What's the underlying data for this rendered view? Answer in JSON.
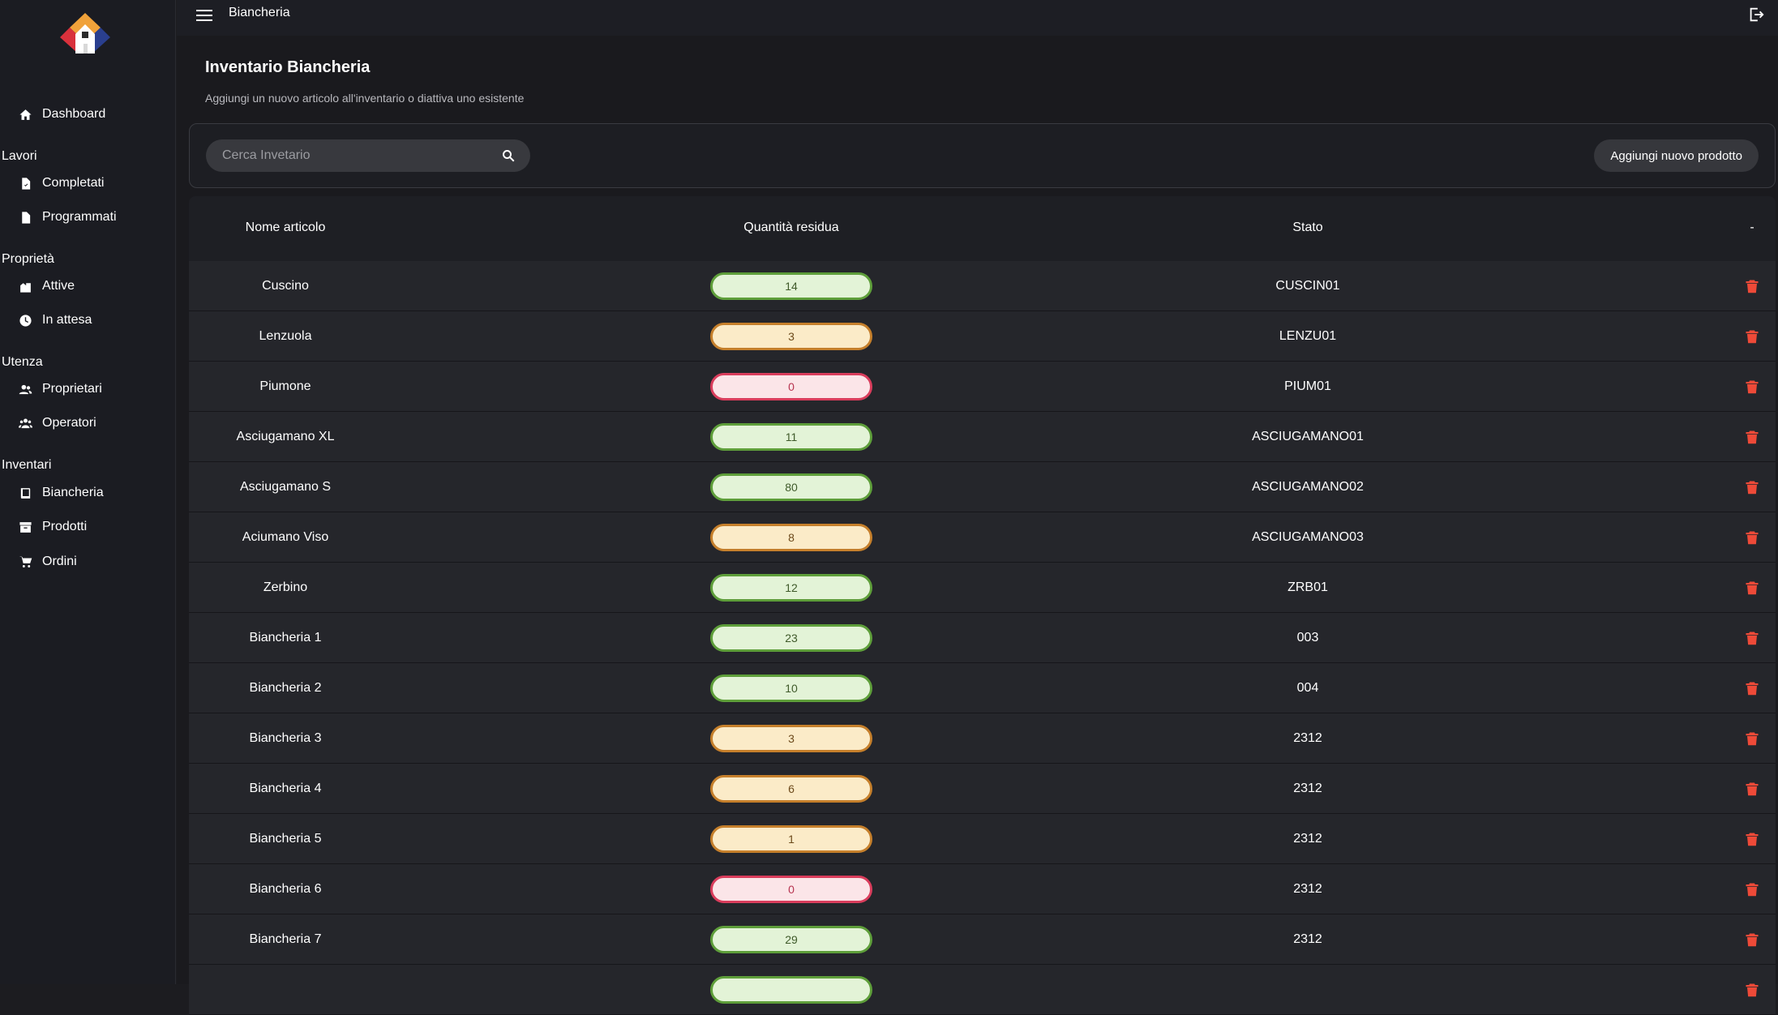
{
  "topbar": {
    "title": "Biancheria"
  },
  "sidebar": {
    "dashboard": "Dashboard",
    "sections": {
      "lavori": "Lavori",
      "proprieta": "Proprietà",
      "utenza": "Utenza",
      "inventari": "Inventari"
    },
    "items": {
      "completati": "Completati",
      "programmati": "Programmati",
      "attive": "Attive",
      "in_attesa": "In attesa",
      "proprietari": "Proprietari",
      "operatori": "Operatori",
      "biancheria": "Biancheria",
      "prodotti": "Prodotti",
      "ordini": "Ordini"
    }
  },
  "page": {
    "title": "Inventario Biancheria",
    "subtitle": "Aggiungi un nuovo articolo all'inventario o diattiva uno esistente"
  },
  "search": {
    "placeholder": "Cerca Invetario"
  },
  "actions": {
    "add_label": "Aggiungi nuovo prodotto"
  },
  "table": {
    "headers": {
      "name": "Nome articolo",
      "qty": "Quantità residua",
      "code": "Stato",
      "action": "-"
    },
    "rows": [
      {
        "name": "Cuscino",
        "qty": "14",
        "level": "ok",
        "code": "CUSCIN01"
      },
      {
        "name": "Lenzuola",
        "qty": "3",
        "level": "low",
        "code": "LENZU01"
      },
      {
        "name": "Piumone",
        "qty": "0",
        "level": "zero",
        "code": "PIUM01"
      },
      {
        "name": "Asciugamano XL",
        "qty": "11",
        "level": "ok",
        "code": "ASCIUGAMANO01"
      },
      {
        "name": "Asciugamano S",
        "qty": "80",
        "level": "ok",
        "code": "ASCIUGAMANO02"
      },
      {
        "name": "Aciumano Viso",
        "qty": "8",
        "level": "low",
        "code": "ASCIUGAMANO03"
      },
      {
        "name": "Zerbino",
        "qty": "12",
        "level": "ok",
        "code": "ZRB01"
      },
      {
        "name": "Biancheria 1",
        "qty": "23",
        "level": "ok",
        "code": "003"
      },
      {
        "name": "Biancheria 2",
        "qty": "10",
        "level": "ok",
        "code": "004"
      },
      {
        "name": "Biancheria 3",
        "qty": "3",
        "level": "low",
        "code": "2312"
      },
      {
        "name": "Biancheria 4",
        "qty": "6",
        "level": "low",
        "code": "2312"
      },
      {
        "name": "Biancheria 5",
        "qty": "1",
        "level": "low",
        "code": "2312"
      },
      {
        "name": "Biancheria 6",
        "qty": "0",
        "level": "zero",
        "code": "2312"
      },
      {
        "name": "Biancheria 7",
        "qty": "29",
        "level": "ok",
        "code": "2312"
      },
      {
        "name": "",
        "qty": "",
        "level": "ok",
        "code": ""
      }
    ]
  },
  "colors": {
    "ok_bg": "#e3f3d7",
    "ok_border": "#5e9e3a",
    "low_bg": "#fbebc8",
    "low_border": "#c57f2b",
    "zero_bg": "#fbe5e8",
    "zero_border": "#d93d5c",
    "delete": "#ee4a38"
  }
}
